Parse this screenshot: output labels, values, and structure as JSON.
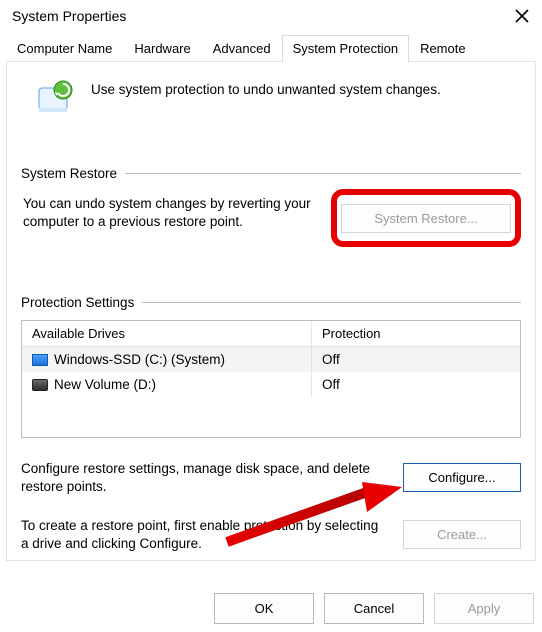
{
  "window": {
    "title": "System Properties"
  },
  "tabs": [
    {
      "label": "Computer Name"
    },
    {
      "label": "Hardware"
    },
    {
      "label": "Advanced"
    },
    {
      "label": "System Protection"
    },
    {
      "label": "Remote"
    }
  ],
  "intro": "Use system protection to undo unwanted system changes.",
  "restore": {
    "header": "System Restore",
    "description": "You can undo system changes by reverting your computer to a previous restore point.",
    "button": "System Restore..."
  },
  "protection": {
    "header": "Protection Settings",
    "col_drive": "Available Drives",
    "col_protection": "Protection",
    "drives": [
      {
        "name": "Windows-SSD (C:) (System)",
        "protection": "Off"
      },
      {
        "name": "New Volume (D:)",
        "protection": "Off"
      }
    ],
    "configure_text": "Configure restore settings, manage disk space, and delete restore points.",
    "configure_button": "Configure...",
    "create_text": "To create a restore point, first enable protection by selecting a drive and clicking Configure.",
    "create_button": "Create..."
  },
  "footer": {
    "ok": "OK",
    "cancel": "Cancel",
    "apply": "Apply"
  }
}
